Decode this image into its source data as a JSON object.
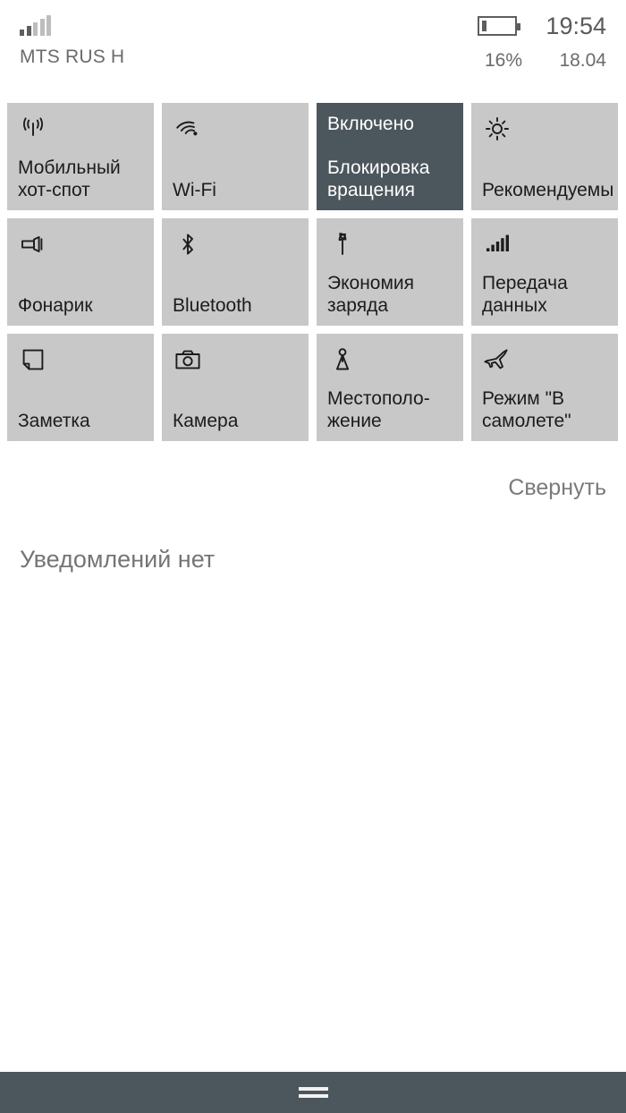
{
  "statusbar": {
    "signal_icon": "signal-bars-icon",
    "signal_bars_total": 5,
    "signal_bars_filled": 2,
    "carrier": "MTS RUS H",
    "battery_icon": "battery-icon",
    "battery_percent_label": "16%",
    "battery_level": 16,
    "clock": "19:54",
    "date": "18.04"
  },
  "quick_actions": {
    "tiles": [
      {
        "icon": "hotspot-icon",
        "label": "Мобильный\nхот-спот",
        "state": "",
        "active": false
      },
      {
        "icon": "wifi-icon",
        "label": "Wi-Fi",
        "state": "",
        "active": false
      },
      {
        "icon": "",
        "label": "Блокировка\nвращения",
        "state": "Включено",
        "active": true
      },
      {
        "icon": "brightness-icon",
        "label": "Рекомендуемы",
        "state": "",
        "active": false
      },
      {
        "icon": "flashlight-icon",
        "label": "Фонарик",
        "state": "",
        "active": false
      },
      {
        "icon": "bluetooth-icon",
        "label": "Bluetooth",
        "state": "",
        "active": false
      },
      {
        "icon": "battery-saver-icon",
        "label": "Экономия\nзаряда",
        "state": "",
        "active": false
      },
      {
        "icon": "cellular-data-icon",
        "label": "Передача\nданных",
        "state": "",
        "active": false
      },
      {
        "icon": "note-icon",
        "label": "Заметка",
        "state": "",
        "active": false
      },
      {
        "icon": "camera-icon",
        "label": "Камера",
        "state": "",
        "active": false
      },
      {
        "icon": "location-icon",
        "label": "Местополо-\nжение",
        "state": "",
        "active": false
      },
      {
        "icon": "airplane-icon",
        "label": "Режим \"В\nсамолете\"",
        "state": "",
        "active": false
      }
    ],
    "collapse_label": "Свернуть"
  },
  "notifications": {
    "empty_label": "Уведомлений нет"
  },
  "navbar": {
    "glyph": "hamburger-nav-icon"
  },
  "colors": {
    "tile_inactive": "#c8c8c8",
    "tile_active": "#4c565d",
    "navbar": "#4c565d",
    "text_primary": "#1c1c1c",
    "text_muted": "#757575",
    "background": "#ffffff"
  }
}
